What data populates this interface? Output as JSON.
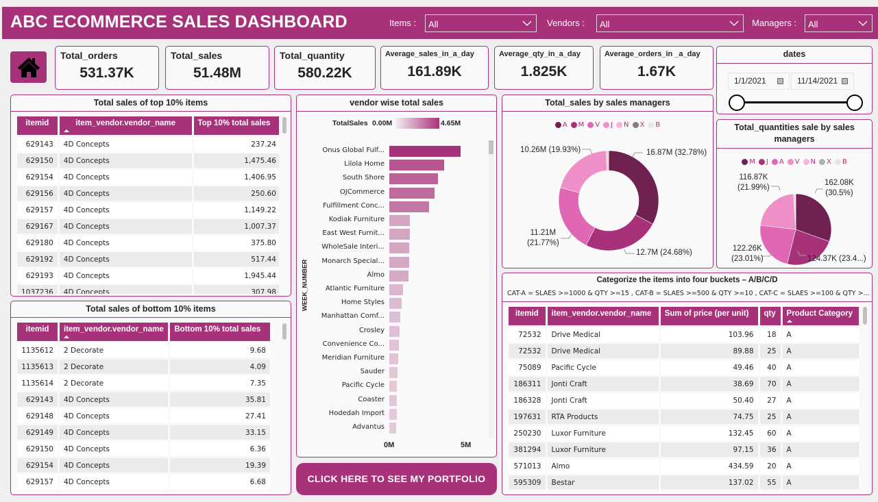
{
  "header": {
    "title": "ABC ECOMMERCE SALES DASHBOARD",
    "filters": [
      {
        "label": "Items :",
        "value": "All"
      },
      {
        "label": "Vendors :",
        "value": "All"
      },
      {
        "label": "Managers :",
        "value": "All"
      }
    ]
  },
  "colors": {
    "brand": "#a83279",
    "background": "#efefef",
    "card": "#f9f9f9"
  },
  "home_icon": "home-icon",
  "kpis": [
    {
      "label": "Total_orders",
      "value": "531.37K"
    },
    {
      "label": "Total_sales",
      "value": "51.48M"
    },
    {
      "label": "Total_quantity",
      "value": "580.22K"
    },
    {
      "label": "Average_sales_in_a_day",
      "value": "161.89K"
    },
    {
      "label": "Average_qty_in_a_day",
      "value": "1.825K"
    },
    {
      "label": "Average_orders_in _a_day",
      "value": "1.67K"
    }
  ],
  "dates": {
    "title": "dates",
    "start": "1/1/2021",
    "end": "11/14/2021",
    "range_fraction": [
      0,
      1
    ]
  },
  "top_table": {
    "title": "Total sales of top 10% items",
    "columns": [
      "itemid",
      "item_vendor.vendor_name",
      "Top 10% total sales"
    ],
    "rows": [
      [
        "629143",
        "4D Concepts",
        "237.24"
      ],
      [
        "629150",
        "4D Concepts",
        "1,475.46"
      ],
      [
        "629154",
        "4D Concepts",
        "1,406.95"
      ],
      [
        "629156",
        "4D Concepts",
        "250.60"
      ],
      [
        "629157",
        "4D Concepts",
        "1,149.22"
      ],
      [
        "629167",
        "4D Concepts",
        "1,007.37"
      ],
      [
        "629180",
        "4D Concepts",
        "375.80"
      ],
      [
        "629192",
        "4D Concepts",
        "517.44"
      ],
      [
        "629193",
        "4D Concepts",
        "1,945.44"
      ],
      [
        "1037236",
        "4D Concepts",
        "307.98"
      ]
    ]
  },
  "bottom_table": {
    "title": "Total sales of bottom 10% items",
    "columns": [
      "itemid",
      "item_vendor.vendor_name",
      "Bottom 10% total sales"
    ],
    "rows": [
      [
        "1135612",
        "2 Decorate",
        "9.68"
      ],
      [
        "1135613",
        "2 Decorate",
        "4.09"
      ],
      [
        "1135614",
        "2 Decorate",
        "7.35"
      ],
      [
        "629143",
        "4D Concepts",
        "35.81"
      ],
      [
        "629148",
        "4D Concepts",
        "27.41"
      ],
      [
        "629149",
        "4D Concepts",
        "33.15"
      ],
      [
        "629150",
        "4D Concepts",
        "6.36"
      ],
      [
        "629154",
        "4D Concepts",
        "19.39"
      ],
      [
        "629157",
        "4D Concepts",
        "6.68"
      ]
    ]
  },
  "chart_data": [
    {
      "type": "bar",
      "orientation": "horizontal",
      "title": "vendor wise total sales",
      "ylabel": "WEEK_NUMBER",
      "xlabel": "",
      "legend": {
        "title": "TotalSales",
        "min_label": "0.00M",
        "max_label": "4.65M",
        "min": 0,
        "max": 4.65,
        "placement": "top"
      },
      "xlim": [
        0,
        5
      ],
      "x_ticks": [
        "0M",
        "5M"
      ],
      "units": "M",
      "categories": [
        "Onus Global Fulf...",
        "Lilola Home",
        "South Shore",
        "OJCommerce",
        "Fulfillment Conc...",
        "Kodiak Furniture",
        "East West Furnit...",
        "WholeSale Interi...",
        "Monarch Special...",
        "Almo",
        "Atlantic Furniture",
        "Home Styles",
        "Manhattan Comf...",
        "Crosley",
        "Convenience Co...",
        "Meridian Furniture",
        "Sauder",
        "Pacific Cycle",
        "Coaster",
        "Hodedah Import",
        "Advantus"
      ],
      "values": [
        4.65,
        3.57,
        3.17,
        2.95,
        2.59,
        1.34,
        1.34,
        1.3,
        1.29,
        1.23,
        0.89,
        0.82,
        0.71,
        0.67,
        0.61,
        0.57,
        0.53,
        0.51,
        0.5,
        0.49,
        0.45
      ]
    },
    {
      "type": "pie",
      "variant": "donut",
      "title": "Total_sales by sales managers",
      "legend": [
        "A",
        "M",
        "V",
        "J",
        "N",
        "X",
        "B"
      ],
      "legend_placement": "top",
      "slices": [
        {
          "name": "A",
          "value": 16.87,
          "percent": 32.78,
          "label": "16.87M (32.78%)",
          "color": "#6f2150"
        },
        {
          "name": "M",
          "value": 12.7,
          "percent": 24.68,
          "label": "12.7M (24.68%)",
          "color": "#a83279"
        },
        {
          "name": "V",
          "value": 11.21,
          "percent": 21.77,
          "label": "11.21M (21.77%)",
          "color": "#e067b4"
        },
        {
          "name": "J",
          "value": 10.26,
          "percent": 19.93,
          "label": "10.26M (19.93%)",
          "color": "#ee8fc8"
        },
        {
          "name": "N",
          "value": 0.25,
          "percent": 0.5,
          "label": "",
          "color": "#f5b5da"
        },
        {
          "name": "X",
          "value": 0.12,
          "percent": 0.24,
          "label": "",
          "color": "#808080"
        },
        {
          "name": "B",
          "value": 0.05,
          "percent": 0.1,
          "label": "",
          "color": "#e6e6e6"
        }
      ]
    },
    {
      "type": "pie",
      "title": "Total_quantities sale by sales managers",
      "legend": [
        "M",
        "J",
        "A",
        "V",
        "N",
        "X",
        "B"
      ],
      "legend_placement": "top",
      "slices": [
        {
          "name": "M",
          "value": 162.08,
          "percent": 30.5,
          "label": "162.08K (30.5%)",
          "color": "#6f2150"
        },
        {
          "name": "J",
          "value": 124.37,
          "percent": 23.4,
          "label": "124.37K (23.4...)",
          "color": "#a83279"
        },
        {
          "name": "A",
          "value": 122.26,
          "percent": 23.01,
          "label": "122.26K (23.01%)",
          "color": "#e067b4"
        },
        {
          "name": "V",
          "value": 116.87,
          "percent": 21.99,
          "label": "116.87K (21.99%)",
          "color": "#ee8fc8"
        },
        {
          "name": "N",
          "value": 3.5,
          "percent": 0.66,
          "label": "",
          "color": "#f5b5da"
        },
        {
          "name": "X",
          "value": 1.6,
          "percent": 0.3,
          "label": "",
          "color": "#b0b0b0"
        },
        {
          "name": "B",
          "value": 0.7,
          "percent": 0.14,
          "label": "",
          "color": "#e6e6e6"
        }
      ]
    }
  ],
  "category_table": {
    "title": "Categorize the items into four buckets – A/B/C/D",
    "subtitle": "CAT-A = SLAES >=1000 & QTY >=15  , CAT-B = SLAES >=500 & QTY >=10  , CAT-C = SLAES >=100 & QTY >...",
    "columns": [
      "itemid",
      "item_vendor.vendor_name",
      "Sum of price (per unit)",
      "qty",
      "Product Category"
    ],
    "rows": [
      [
        "72532",
        "Drive Medical",
        "103.96",
        "18",
        "A"
      ],
      [
        "72532",
        "Drive Medical",
        "89.88",
        "25",
        "A"
      ],
      [
        "75089",
        "Pacific Cycle",
        "49.46",
        "40",
        "A"
      ],
      [
        "186311",
        "Jonti Craft",
        "38.69",
        "70",
        "A"
      ],
      [
        "186328",
        "Jonti Craft",
        "50.40",
        "27",
        "A"
      ],
      [
        "197631",
        "RTA Products",
        "74.75",
        "25",
        "A"
      ],
      [
        "250230",
        "Luxor Furniture",
        "132.45",
        "60",
        "A"
      ],
      [
        "381294",
        "Luxor Furniture",
        "97.15",
        "36",
        "A"
      ],
      [
        "571013",
        "Almo",
        "434.59",
        "20",
        "A"
      ],
      [
        "595309",
        "Bestar",
        "137.02",
        "55",
        "A"
      ]
    ]
  },
  "portfolio_button": {
    "label": "CLICK HERE TO SEE MY PORTFOLIO"
  }
}
